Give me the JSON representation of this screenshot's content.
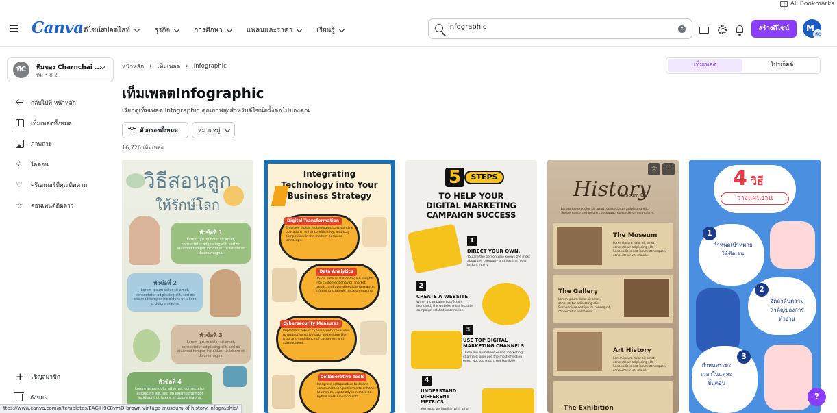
{
  "bookmarks": {
    "label": "All Bookmarks"
  },
  "header": {
    "logo": "Canva",
    "nav": [
      {
        "label": "ดีไซน์สปอตไลท์"
      },
      {
        "label": "ธุรกิจ"
      },
      {
        "label": "การศึกษา"
      },
      {
        "label": "แพลนและราคา"
      },
      {
        "label": "เรียนรู้"
      }
    ],
    "search_value": "infographic",
    "clear_symbol": "✕",
    "create_button": "สร้างดีไซน์",
    "avatar_initial": "M",
    "avatar_sub": "ทัC"
  },
  "sidebar": {
    "team": {
      "avatar": "ทัC",
      "name": "ทีมของ Charnchai ...",
      "sub": "ทีม • 8 2"
    },
    "items": [
      {
        "label": "กลับไปที่ หน้าหลัก"
      },
      {
        "label": "เท็มเพลตทั้งหมด"
      },
      {
        "label": "ภาพถ่าย"
      },
      {
        "label": "ไอคอน"
      },
      {
        "label": "ครีเอเตอร์ที่คุณติดตาม"
      },
      {
        "label": "คอนเทนต์ติดดาว"
      }
    ],
    "invite": "เชิญสมาชิก",
    "trash": "ถังขยะ"
  },
  "main": {
    "breadcrumb": [
      "หน้าหลัก",
      "เท็มเพลต",
      "Infographic"
    ],
    "title": "เท็มเพลตInfographic",
    "description": "เรียกดูเท็มเพลต Infographic คุณภาพสูงสำหรับดีไซน์ครั้งต่อไปของคุณ",
    "filter_all": "ตัวกรองทั้งหมด",
    "category": "หมวดหมู่",
    "count": "16,726 เท็มเพลต",
    "segments": {
      "templates": "เท็มเพลต",
      "projects": "โปรเจ็คต์"
    }
  },
  "cards": {
    "c1": {
      "title_line1": "วิธีสอนลูก",
      "title_line2": "ให้รักษ์โลก",
      "topics": [
        "หัวข้อที่ 1",
        "หัวข้อที่ 2",
        "หัวข้อที่ 3",
        "หัวข้อที่ 4"
      ],
      "lorem": "Lorem ipsum dolor sit amet, consectetur adipiscing elit, sed do eiusmod tempor incididunt ut labore et dolore magna."
    },
    "c2": {
      "title": [
        "Integrating",
        "Technology into Your",
        "Business Strategy"
      ],
      "sections": [
        {
          "heading": "Digital Transformation",
          "text": "Embrace digital technologies to streamline operations, enhance efficiency, and stay competitive in the modern business landscape."
        },
        {
          "heading": "Data Analytics",
          "text": "Utilize data analytics to gain insights into customer behavior, market trends, and operational performance, informing strategic decision-making."
        },
        {
          "heading": "Cybersecurity Measures",
          "text": "Implement robust cybersecurity measures to protect sensitive data and ensure the trust and confidence of customers and stakeholders."
        },
        {
          "heading": "Collaborative Tools",
          "text": "Integrate collaborative tools and communication platforms to enhance teamwork, especially in remote or hybrid work environments."
        }
      ]
    },
    "c3": {
      "big": "5",
      "steps_word": "STEPS",
      "title": [
        "TO HELP YOUR",
        "DIGITAL MARKETING",
        "CAMPAIGN SUCCESS"
      ],
      "steps": [
        {
          "n": "1",
          "heading": "DIRECT YOUR OWN.",
          "text": "You are the person who knows the most about the company and has the most insight into it"
        },
        {
          "n": "2",
          "heading": "CREATE A WEBSITE.",
          "text": "When a campaign is officially launched, the website must include campaign-related information"
        },
        {
          "n": "3",
          "heading": "USE TOP DIGITAL MARKETING CHANNELS.",
          "text": "There are numerous online marketing channels; only use the most effective ones. Not too much, not too little"
        },
        {
          "n": "4",
          "heading": "UNDERSTAND DIFFERENT METRICS.",
          "text": "You must be familiar with all of"
        }
      ]
    },
    "c4": {
      "small": "Museum Of",
      "title": "History",
      "sections": [
        "The Museum",
        "The Gallery",
        "Art History",
        "The Exhibition"
      ],
      "lorem": "Lorem ipsum dolor sit amet, consectetur adipiscing elit. Suspendisse sed ipsum consequat, consectetur vel mauris."
    },
    "c5": {
      "big": "4",
      "title_rest": "วิธี",
      "subtitle": "วางแผนงาน",
      "steps": [
        {
          "n": "1",
          "text": "กำหนดเป้าหมายให้ชัดเจน"
        },
        {
          "n": "2",
          "text": "จัดลำดับความสำคัญของการทำงาน"
        },
        {
          "n": "3",
          "text": "กำหนดระยะเวลาในแต่ละขั้นตอน"
        }
      ]
    }
  },
  "card_actions": {
    "star": "☆",
    "more": "···"
  },
  "help": "?",
  "status_url": "ttps://www.canva.com/p/templates/EAGJH9C8vmQ-brown-vintage-museum-of-history-infographic/"
}
